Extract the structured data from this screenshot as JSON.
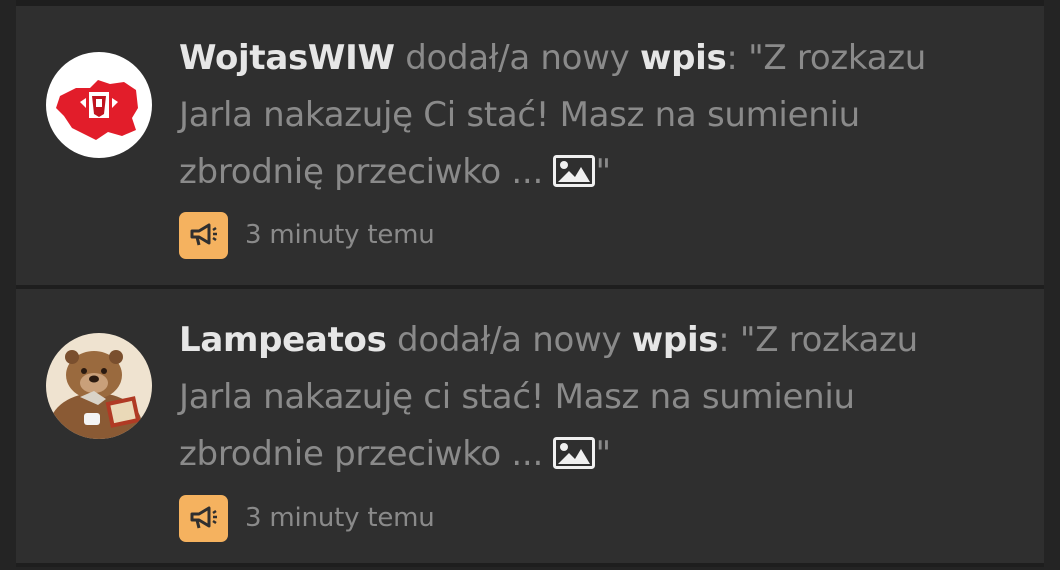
{
  "feed": {
    "items": [
      {
        "username": "WojtasWIW",
        "action": " dodał/a nowy ",
        "target": "wpis",
        "quote": ": \"Z rozkazu Jarla nakazuję Ci stać! Masz na sumieniu zbrodnię przeciwko ... ",
        "quote_end": "\"",
        "time": "3 minuty temu",
        "avatar_icon": "poland-map-eagle-avatar",
        "badge_icon": "megaphone-icon",
        "embedded_icon": "image-icon"
      },
      {
        "username": "Lampeatos",
        "action": " dodał/a nowy ",
        "target": "wpis",
        "quote": ": \"Z rozkazu Jarla nakazuję ci stać! Masz na sumieniu zbrodnie przeciwko ... ",
        "quote_end": "\"",
        "time": "3 minuty temu",
        "avatar_icon": "beaver-reading-avatar",
        "badge_icon": "megaphone-icon",
        "embedded_icon": "image-icon"
      }
    ]
  },
  "colors": {
    "background": "#2f2f2f",
    "username": "#e6e6e6",
    "text": "#8a8a8a",
    "badge": "#f5b25f"
  }
}
